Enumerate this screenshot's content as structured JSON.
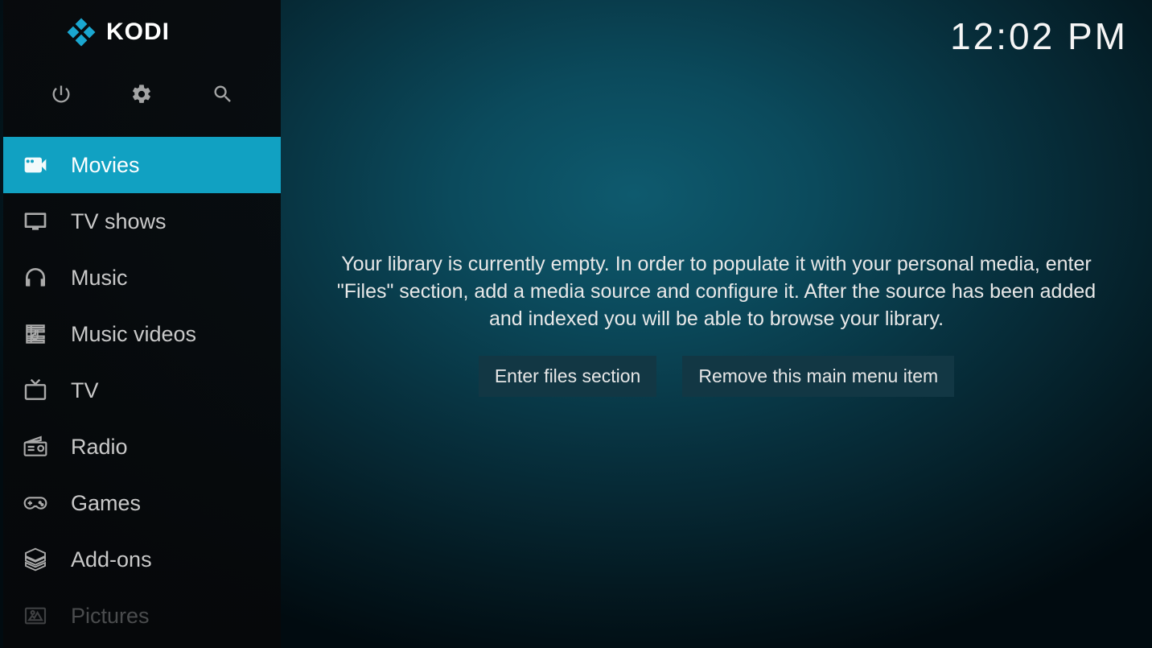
{
  "app": {
    "name": "KODI"
  },
  "clock": "12:02 PM",
  "sidebar": {
    "items": [
      {
        "id": "movies",
        "label": "Movies",
        "icon": "movies-icon",
        "active": true
      },
      {
        "id": "tvshows",
        "label": "TV shows",
        "icon": "tv-shows-icon",
        "active": false
      },
      {
        "id": "music",
        "label": "Music",
        "icon": "music-icon",
        "active": false
      },
      {
        "id": "musicvideos",
        "label": "Music videos",
        "icon": "music-videos-icon",
        "active": false
      },
      {
        "id": "tv",
        "label": "TV",
        "icon": "tv-icon",
        "active": false
      },
      {
        "id": "radio",
        "label": "Radio",
        "icon": "radio-icon",
        "active": false
      },
      {
        "id": "games",
        "label": "Games",
        "icon": "games-icon",
        "active": false
      },
      {
        "id": "addons",
        "label": "Add-ons",
        "icon": "addons-icon",
        "active": false
      },
      {
        "id": "pictures",
        "label": "Pictures",
        "icon": "pictures-icon",
        "active": false,
        "faded": true
      }
    ]
  },
  "main": {
    "empty_message": "Your library is currently empty. In order to populate it with your personal media, enter \"Files\" section, add a media source and configure it. After the source has been added and indexed you will be able to browse your library.",
    "buttons": {
      "enter_files": "Enter files section",
      "remove_item": "Remove this main menu item"
    }
  }
}
